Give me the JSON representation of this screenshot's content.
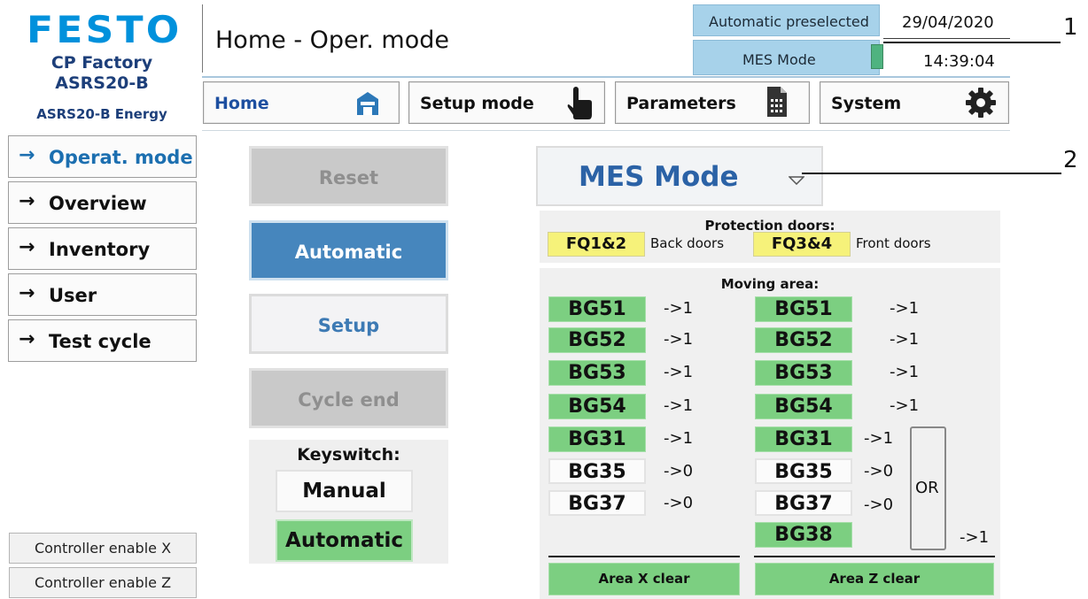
{
  "brand": {
    "logo_text": "FESTO",
    "line1": "CP Factory",
    "line2": "ASRS20-B",
    "line3": "ASRS20-B Energy"
  },
  "header": {
    "title": "Home - Oper. mode",
    "status_auto": "Automatic preselected",
    "status_mode": "MES Mode",
    "date": "29/04/2020",
    "time": "14:39:04",
    "callout_1": "1",
    "callout_2": "2"
  },
  "nav": {
    "home": "Home",
    "setup": "Setup mode",
    "parameters": "Parameters",
    "system": "System"
  },
  "sidebar": {
    "items": [
      {
        "label": "Operat. mode",
        "active": true
      },
      {
        "label": "Overview"
      },
      {
        "label": "Inventory"
      },
      {
        "label": "User"
      },
      {
        "label": "Test cycle"
      }
    ],
    "controller_x": "Controller enable X",
    "controller_z": "Controller enable Z"
  },
  "controls": {
    "reset": "Reset",
    "automatic": "Automatic",
    "setup": "Setup",
    "cycle_end": "Cycle end",
    "keyswitch_title": "Keyswitch:",
    "key_manual": "Manual",
    "key_automatic": "Automatic"
  },
  "mode_dropdown": {
    "selected": "MES Mode"
  },
  "protection": {
    "title": "Protection doors:",
    "fq12": "FQ1&2",
    "back": "Back doors",
    "fq34": "FQ3&4",
    "front": "Front doors"
  },
  "moving": {
    "title": "Moving area:",
    "left": [
      {
        "name": "BG51",
        "value": "->1",
        "active": true
      },
      {
        "name": "BG52",
        "value": "->1",
        "active": true
      },
      {
        "name": "BG53",
        "value": "->1",
        "active": true
      },
      {
        "name": "BG54",
        "value": "->1",
        "active": true
      },
      {
        "name": "BG31",
        "value": "->1",
        "active": true
      },
      {
        "name": "BG35",
        "value": "->0",
        "active": false
      },
      {
        "name": "BG37",
        "value": "->0",
        "active": false
      }
    ],
    "right": [
      {
        "name": "BG51",
        "value": "->1",
        "active": true
      },
      {
        "name": "BG52",
        "value": "->1",
        "active": true
      },
      {
        "name": "BG53",
        "value": "->1",
        "active": true
      },
      {
        "name": "BG54",
        "value": "->1",
        "active": true
      },
      {
        "name": "BG31",
        "value": "->1",
        "active": true
      },
      {
        "name": "BG35",
        "value": "->0",
        "active": false
      },
      {
        "name": "BG37",
        "value": "->0",
        "active": false
      },
      {
        "name": "BG38",
        "value": "",
        "active": true
      }
    ],
    "or_label": "OR",
    "or_value": "->1",
    "area_x": "Area X clear",
    "area_z": "Area Z clear"
  },
  "colors": {
    "accent": "#4686bd",
    "status_blue": "#a7d2ea",
    "ok_green": "#7ccf81",
    "door_yellow": "#f6f27a",
    "logo_blue": "#0091dc"
  }
}
